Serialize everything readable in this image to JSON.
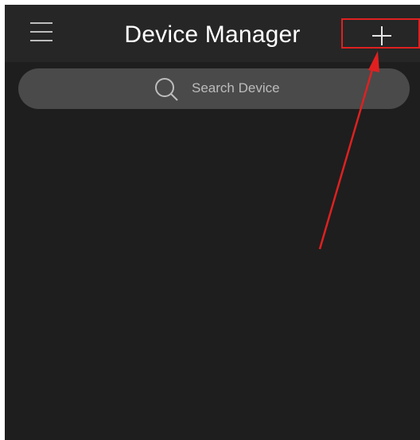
{
  "header": {
    "title": "Device Manager",
    "menu_icon": "hamburger-menu-icon",
    "add_icon": "plus-icon"
  },
  "search": {
    "placeholder": "Search Device",
    "icon": "search-icon"
  },
  "device_list": {
    "items": []
  },
  "annotation": {
    "highlight_color": "#e02020",
    "note": ""
  },
  "colors": {
    "background": "#1e1e1e",
    "topbar": "#262626",
    "search_bar": "#4a4a4a",
    "title_text": "#ffffff",
    "placeholder_text": "#bcbcbc",
    "annotation_red": "#e02020"
  }
}
